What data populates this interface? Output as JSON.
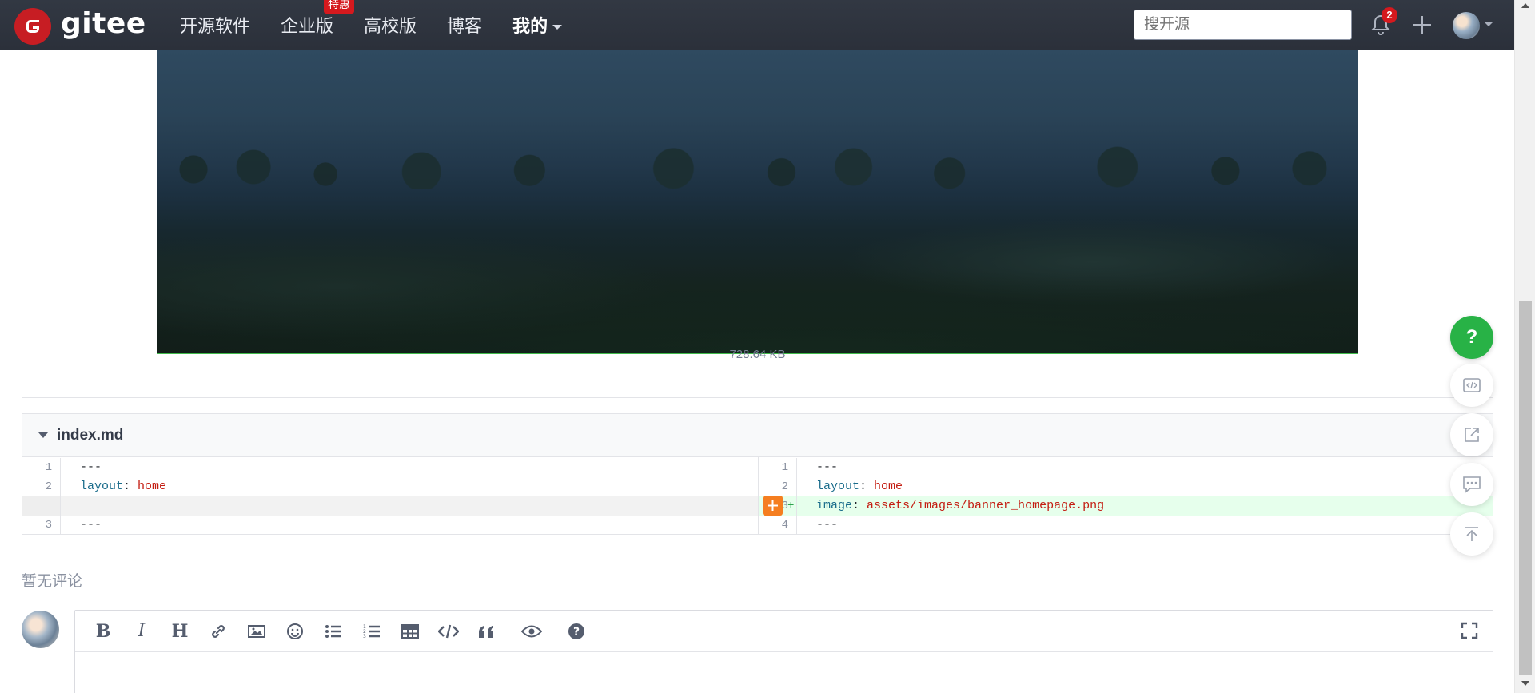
{
  "header": {
    "logo_text": "gitee",
    "nav": [
      {
        "label": "开源软件"
      },
      {
        "label": "企业版",
        "badge": "特惠"
      },
      {
        "label": "高校版"
      },
      {
        "label": "博客"
      },
      {
        "label": "我的"
      }
    ],
    "search_placeholder": "搜开源",
    "notification_count": "2"
  },
  "image_preview": {
    "file_size": "728.64 KB"
  },
  "diff": {
    "filename": "index.md",
    "left": [
      {
        "ln": "1",
        "text": "---"
      },
      {
        "ln": "2",
        "key": "layout",
        "sep": ": ",
        "val": "home"
      },
      {
        "ln": "",
        "text": ""
      },
      {
        "ln": "3",
        "text": "---"
      }
    ],
    "right": [
      {
        "ln": "1",
        "text": "---"
      },
      {
        "ln": "2",
        "key": "layout",
        "sep": ": ",
        "val": "home"
      },
      {
        "ln": "3",
        "key": "image",
        "sep": ": ",
        "val": "assets/images/banner_homepage.png",
        "added": true
      },
      {
        "ln": "4",
        "text": "---"
      }
    ]
  },
  "comments": {
    "empty_text": "暂无评论"
  },
  "toolbar_icons": [
    "bold-icon",
    "italic-icon",
    "heading-icon",
    "link-icon",
    "image-icon",
    "emoji-icon",
    "bullet-list-icon",
    "numbered-list-icon",
    "table-icon",
    "code-icon",
    "quote-icon",
    "preview-icon",
    "help-icon"
  ],
  "colors": {
    "brand_red": "#c71d23",
    "navbar_bg": "#2e3440",
    "help_green": "#28b246",
    "add_orange": "#f57e20",
    "added_line_bg": "#e6ffec",
    "yaml_value_red": "#c41d12"
  }
}
